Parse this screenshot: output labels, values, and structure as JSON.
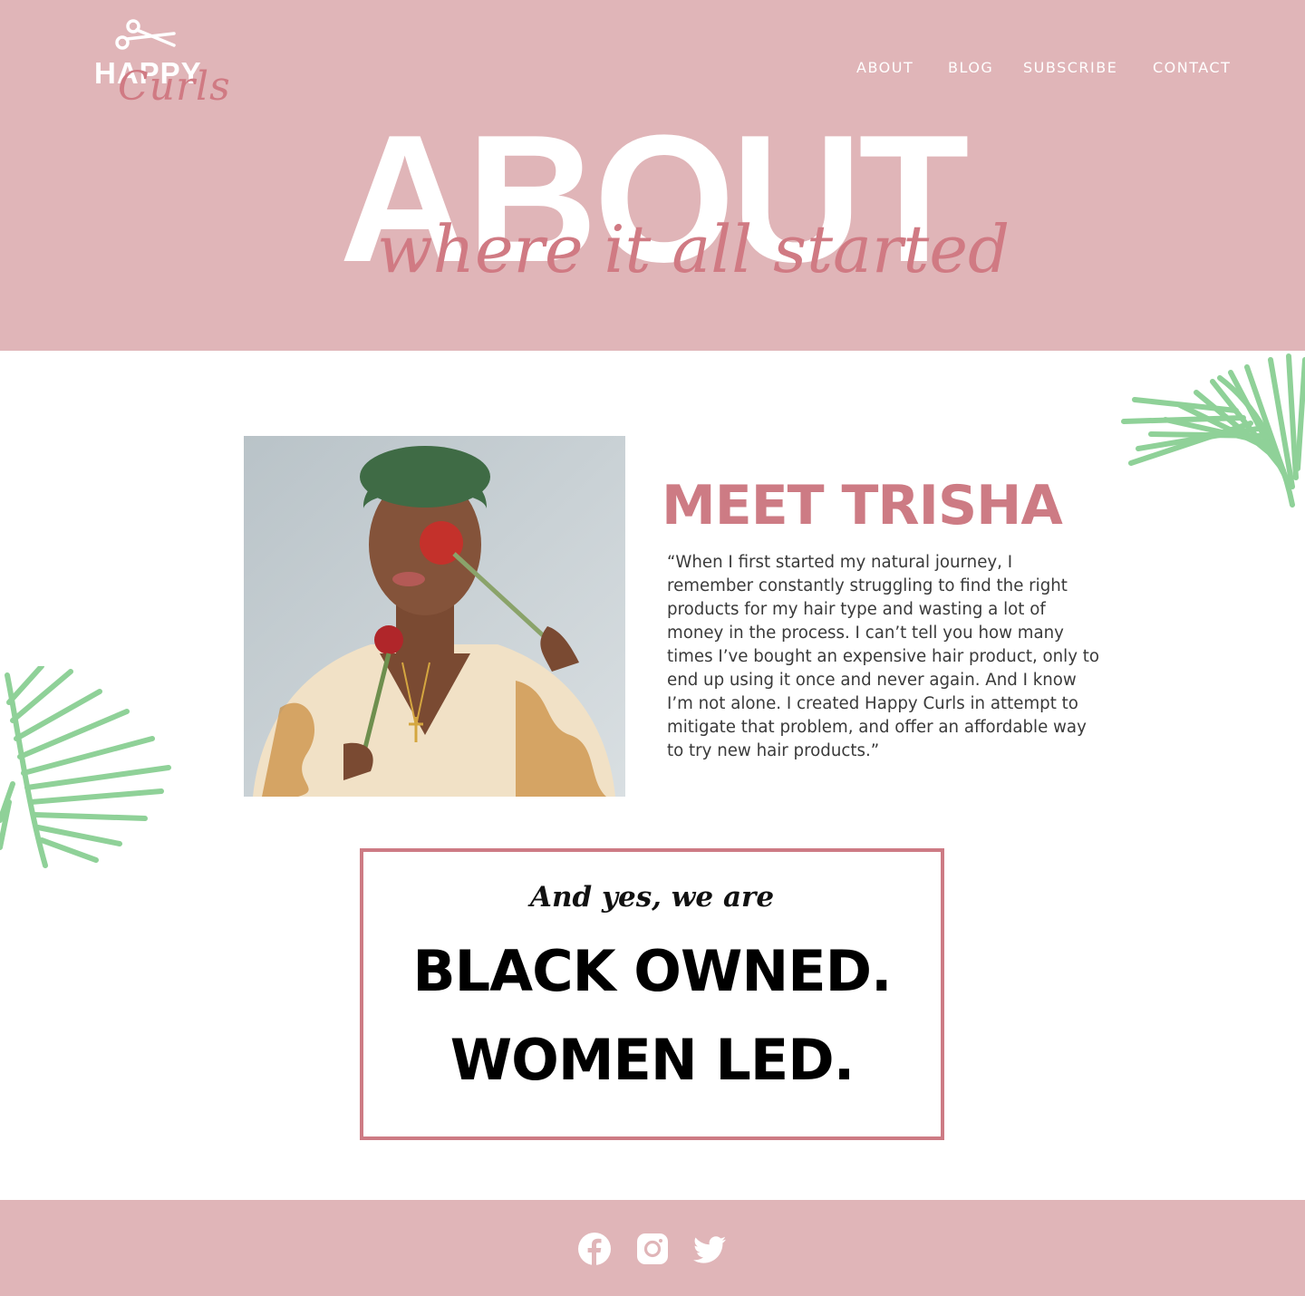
{
  "logo": {
    "line1": "HAPPY",
    "line2": "Curls",
    "icon": "scissors-icon"
  },
  "nav": {
    "items": [
      {
        "label": "ABOUT"
      },
      {
        "label": "BLOG"
      },
      {
        "label": "SUBSCRIBE"
      },
      {
        "label": "CONTACT"
      }
    ]
  },
  "hero": {
    "title": "ABOUT",
    "subtitle": "where it all started"
  },
  "intro": {
    "heading": "MEET TRISHA",
    "quote": "“When I first started my natural journey, I remember constantly struggling to find the right products for my hair type and wasting a lot of money in the process. I can’t tell you how many times I’ve bought an expensive hair product, only to end up using it once and never again. And I know I’m not alone. I created Happy Curls in attempt to mitigate that problem, and offer an affordable way to try new hair products.”"
  },
  "badge": {
    "intro": "And yes, we are",
    "line1": "BLACK OWNED.",
    "line2": "WOMEN LED."
  },
  "footer": {
    "social": [
      {
        "icon": "facebook-icon"
      },
      {
        "icon": "instagram-icon"
      },
      {
        "icon": "twitter-icon"
      }
    ]
  },
  "colors": {
    "header_bg": "#e0b5b8",
    "accent_pink": "#cd7b84",
    "leaf_green": "#8fd198",
    "text_dark": "#3a3a3a",
    "white": "#ffffff"
  }
}
